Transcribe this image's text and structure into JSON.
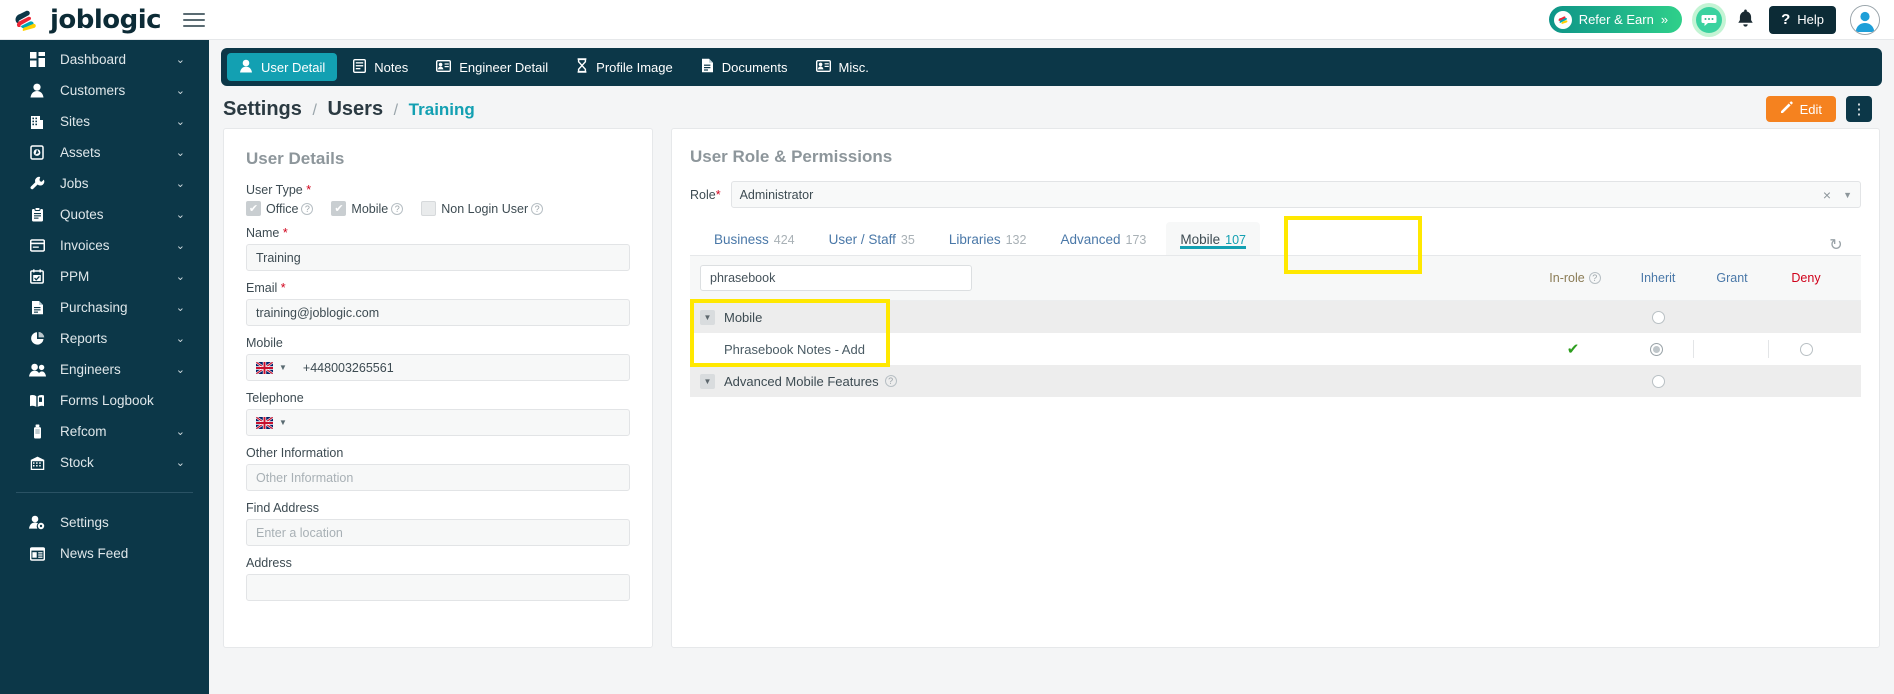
{
  "topbar": {
    "brand": "joblogic",
    "refer_label": "Refer & Earn",
    "refer_chevrons": "»",
    "help_label": "Help",
    "help_icon_glyph": "?"
  },
  "sidebar": {
    "items": [
      {
        "label": "Dashboard",
        "icon": "dashboard-icon",
        "chevron": "⌄"
      },
      {
        "label": "Customers",
        "icon": "customers-icon",
        "chevron": "⌄"
      },
      {
        "label": "Sites",
        "icon": "sites-icon",
        "chevron": "⌄"
      },
      {
        "label": "Assets",
        "icon": "assets-icon",
        "chevron": "⌄"
      },
      {
        "label": "Jobs",
        "icon": "jobs-wrench-icon",
        "chevron": "⌄"
      },
      {
        "label": "Quotes",
        "icon": "quotes-clipboard-icon",
        "chevron": "⌄"
      },
      {
        "label": "Invoices",
        "icon": "invoices-icon",
        "chevron": "⌄"
      },
      {
        "label": "PPM",
        "icon": "ppm-calendar-icon",
        "chevron": "⌄"
      },
      {
        "label": "Purchasing",
        "icon": "purchasing-doc-icon",
        "chevron": "⌄"
      },
      {
        "label": "Reports",
        "icon": "reports-pie-icon",
        "chevron": "⌄"
      },
      {
        "label": "Engineers",
        "icon": "engineers-icon",
        "chevron": "⌄"
      },
      {
        "label": "Forms Logbook",
        "icon": "forms-logbook-icon",
        "chevron": ""
      },
      {
        "label": "Refcom",
        "icon": "refcom-icon",
        "chevron": "⌄"
      },
      {
        "label": "Stock",
        "icon": "stock-icon",
        "chevron": "⌄"
      }
    ],
    "footer_items": [
      {
        "label": "Settings",
        "icon": "settings-user-gear-icon"
      },
      {
        "label": "News Feed",
        "icon": "news-feed-icon"
      }
    ]
  },
  "tabbar": {
    "tabs": [
      {
        "label": "User Detail",
        "icon": "user-icon",
        "active": true
      },
      {
        "label": "Notes",
        "icon": "notes-icon",
        "active": false
      },
      {
        "label": "Engineer Detail",
        "icon": "id-card-icon",
        "active": false
      },
      {
        "label": "Profile Image",
        "icon": "hourglass-icon",
        "active": false
      },
      {
        "label": "Documents",
        "icon": "document-icon",
        "active": false
      },
      {
        "label": "Misc.",
        "icon": "misc-card-icon",
        "active": false
      }
    ]
  },
  "breadcrumb": {
    "root": "Settings",
    "sep1": "/",
    "section": "Users",
    "sep2": "/",
    "leaf": "Training"
  },
  "actions": {
    "edit_label": "Edit",
    "kebab_glyph": "⋮"
  },
  "user_details": {
    "title": "User Details",
    "user_type_label": "User Type",
    "required_mark": "*",
    "checkboxes": [
      {
        "label": "Office",
        "checked": true,
        "help": "?"
      },
      {
        "label": "Mobile",
        "checked": true,
        "help": "?"
      },
      {
        "label": "Non Login User",
        "checked": false,
        "help": "?"
      }
    ],
    "fields": [
      {
        "label": "Name",
        "required": true,
        "value": "Training",
        "placeholder": "",
        "type": "text"
      },
      {
        "label": "Email",
        "required": true,
        "value": "training@joblogic.com",
        "placeholder": "",
        "type": "text"
      },
      {
        "label": "Mobile",
        "required": false,
        "value": "+448003265561",
        "placeholder": "",
        "type": "tel"
      },
      {
        "label": "Telephone",
        "required": false,
        "value": "",
        "placeholder": "",
        "type": "tel"
      },
      {
        "label": "Other Information",
        "required": false,
        "value": "",
        "placeholder": "Other Information",
        "type": "text"
      },
      {
        "label": "Find Address",
        "required": false,
        "value": "",
        "placeholder": "Enter a location",
        "type": "text"
      },
      {
        "label": "Address",
        "required": false,
        "value": "",
        "placeholder": "",
        "type": "text"
      }
    ]
  },
  "permissions": {
    "title": "User Role & Permissions",
    "role_label": "Role",
    "role_required": "*",
    "role_value": "Administrator",
    "clear_glyph": "×",
    "dropdown_glyph": "▼",
    "tabs": [
      {
        "label": "Business",
        "count": "424",
        "active": false
      },
      {
        "label": "User / Staff",
        "count": "35",
        "active": false
      },
      {
        "label": "Libraries",
        "count": "132",
        "active": false
      },
      {
        "label": "Advanced",
        "count": "173",
        "active": false
      },
      {
        "label": "Mobile",
        "count": "107",
        "active": true
      }
    ],
    "search_value": "phrasebook",
    "search_placeholder": "",
    "columns": [
      {
        "label": "In-role",
        "help": "?"
      },
      {
        "label": "Inherit"
      },
      {
        "label": "Grant"
      },
      {
        "label": "Deny"
      }
    ],
    "refresh_glyph": "↻",
    "rows": [
      {
        "name": "Mobile",
        "type": "group",
        "toggle": "▼",
        "help": "",
        "in_role": "",
        "inherit": "empty",
        "grant": "",
        "deny": ""
      },
      {
        "name": "Phrasebook Notes - Add",
        "type": "leaf",
        "toggle": "",
        "help": "",
        "in_role": "✔",
        "inherit": "selected",
        "grant": "",
        "deny": "empty"
      },
      {
        "name": "Advanced Mobile Features",
        "type": "group",
        "toggle": "▼",
        "help": "?",
        "in_role": "",
        "inherit": "empty",
        "grant": "",
        "deny": ""
      }
    ]
  },
  "colors": {
    "brand_dark": "#0c3748",
    "accent_teal": "#13a0b2",
    "edit_orange": "#f5821f",
    "highlight_yellow": "#ffe800",
    "link_blue": "#4a78a8",
    "deny_red": "#d0021b",
    "check_green": "#2e9e1f"
  }
}
